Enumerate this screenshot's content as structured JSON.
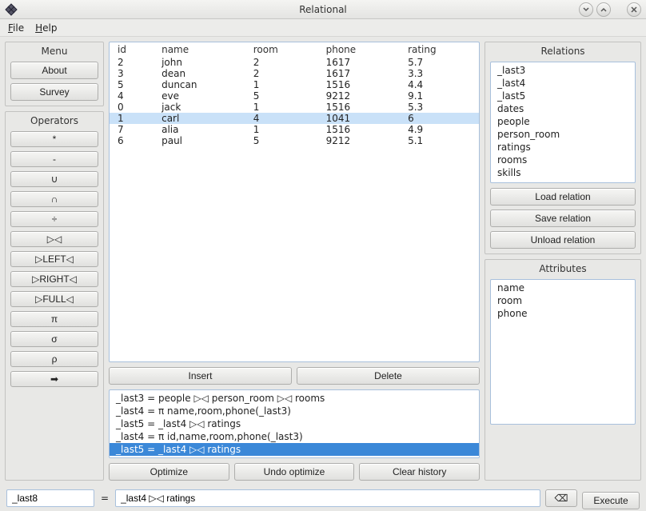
{
  "window": {
    "title": "Relational",
    "min_icon": "minimize",
    "max_icon": "maximize",
    "close_icon": "close"
  },
  "menubar": {
    "file": "File",
    "help": "Help"
  },
  "left": {
    "menu_label": "Menu",
    "about": "About",
    "survey": "Survey",
    "ops_label": "Operators",
    "ops": [
      "*",
      "-",
      "∪",
      "∩",
      "÷",
      "▷◁",
      "▷LEFT◁",
      "▷RIGHT◁",
      "▷FULL◁",
      "π",
      "σ",
      "ρ",
      "➡"
    ]
  },
  "center": {
    "headers": [
      "id",
      "name",
      "room",
      "phone",
      "rating"
    ],
    "rows": [
      {
        "id": "2",
        "name": "john",
        "room": "2",
        "phone": "1617",
        "rating": "5.7",
        "selected": false
      },
      {
        "id": "3",
        "name": "dean",
        "room": "2",
        "phone": "1617",
        "rating": "3.3",
        "selected": false
      },
      {
        "id": "5",
        "name": "duncan",
        "room": "1",
        "phone": "1516",
        "rating": "4.4",
        "selected": false
      },
      {
        "id": "4",
        "name": "eve",
        "room": "5",
        "phone": "9212",
        "rating": "9.1",
        "selected": false
      },
      {
        "id": "0",
        "name": "jack",
        "room": "1",
        "phone": "1516",
        "rating": "5.3",
        "selected": false
      },
      {
        "id": "1",
        "name": "carl",
        "room": "4",
        "phone": "1041",
        "rating": "6",
        "selected": true
      },
      {
        "id": "7",
        "name": "alia",
        "room": "1",
        "phone": "1516",
        "rating": "4.9",
        "selected": false
      },
      {
        "id": "6",
        "name": "paul",
        "room": "5",
        "phone": "9212",
        "rating": "5.1",
        "selected": false
      }
    ],
    "insert": "Insert",
    "delete": "Delete",
    "history": [
      {
        "text": "_last3 = people ▷◁ person_room ▷◁ rooms",
        "selected": false
      },
      {
        "text": "_last4 = π name,room,phone(_last3)",
        "selected": false
      },
      {
        "text": "_last5 = _last4 ▷◁ ratings",
        "selected": false
      },
      {
        "text": "_last4 = π id,name,room,phone(_last3)",
        "selected": false
      },
      {
        "text": "_last5 = _last4 ▷◁ ratings",
        "selected": true
      }
    ],
    "optimize": "Optimize",
    "undo_optimize": "Undo optimize",
    "clear_history": "Clear history"
  },
  "right": {
    "relations_label": "Relations",
    "relations": [
      "_last3",
      "_last4",
      "_last5",
      "dates",
      "people",
      "person_room",
      "ratings",
      "rooms",
      "skills"
    ],
    "load": "Load relation",
    "save": "Save relation",
    "unload": "Unload relation",
    "attributes_label": "Attributes",
    "attributes": [
      "name",
      "room",
      "phone"
    ]
  },
  "bottom": {
    "result_name": "_last8",
    "eq": "=",
    "expression": "_last4 ▷◁ ratings",
    "backspace_icon": "⌫",
    "execute": "Execute"
  }
}
